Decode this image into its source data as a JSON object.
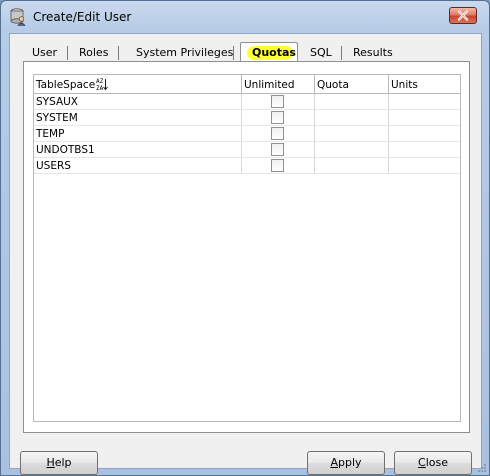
{
  "window": {
    "title": "Create/Edit User"
  },
  "tabs": [
    {
      "label": "User"
    },
    {
      "label": "Roles"
    },
    {
      "label": "System Privileges"
    },
    {
      "label": "Quotas",
      "active": true
    },
    {
      "label": "SQL"
    },
    {
      "label": "Results"
    }
  ],
  "table": {
    "columns": [
      "TableSpace",
      "Unlimited",
      "Quota",
      "Units"
    ],
    "rows": [
      {
        "tablespace": "SYSAUX",
        "unlimited": false,
        "quota": "",
        "units": ""
      },
      {
        "tablespace": "SYSTEM",
        "unlimited": false,
        "quota": "",
        "units": ""
      },
      {
        "tablespace": "TEMP",
        "unlimited": false,
        "quota": "",
        "units": ""
      },
      {
        "tablespace": "UNDOTBS1",
        "unlimited": false,
        "quota": "",
        "units": ""
      },
      {
        "tablespace": "USERS",
        "unlimited": false,
        "quota": "",
        "units": ""
      }
    ]
  },
  "buttons": {
    "help": {
      "first": "H",
      "rest": "elp"
    },
    "apply": {
      "first": "A",
      "rest": "pply"
    },
    "close": {
      "first": "C",
      "rest": "lose"
    }
  },
  "colors": {
    "active_tab_highlight": "#ffff33",
    "titlebar": "#b6cbe6",
    "close_button": "#c8452c"
  },
  "icons": {
    "app": "database-user-icon",
    "close": "close-icon",
    "sort": "sort-az-icon"
  }
}
